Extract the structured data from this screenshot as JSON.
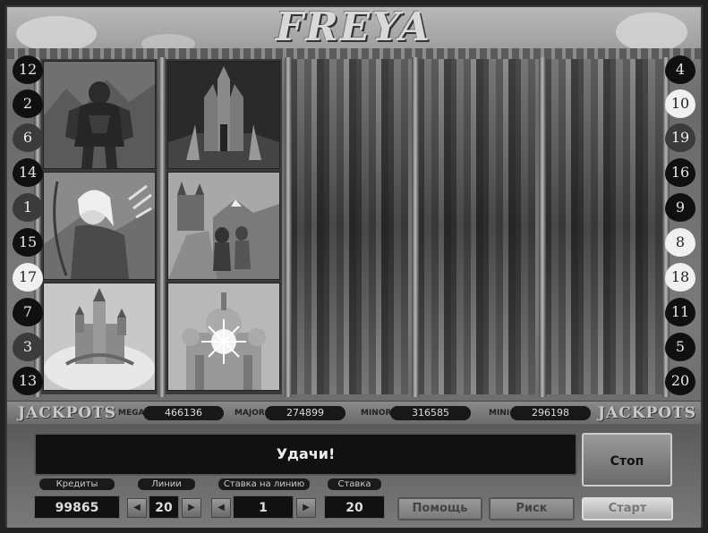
{
  "game": {
    "logo": "FREYA",
    "message": "Удачи!",
    "stop_label": "Стоп"
  },
  "lines_left": [
    "12",
    "2",
    "6",
    "14",
    "1",
    "15",
    "17",
    "7",
    "3",
    "13"
  ],
  "lines_right": [
    "4",
    "10",
    "19",
    "16",
    "9",
    "8",
    "18",
    "11",
    "5",
    "20"
  ],
  "reels": [
    {
      "symbols": [
        "warrior-troll",
        "elf-archer",
        "fairy-castle"
      ]
    },
    {
      "symbols": [
        "dark-cathedral",
        "mountain-travelers",
        "golden-temple"
      ]
    },
    {
      "symbols": [
        "spinning",
        "spinning",
        "spinning"
      ]
    },
    {
      "symbols": [
        "spinning",
        "spinning",
        "spinning"
      ]
    },
    {
      "symbols": [
        "spinning",
        "spinning",
        "spinning"
      ]
    }
  ],
  "jackpots": {
    "title_left": "JACKPOTS",
    "title_right": "JACKPOTS",
    "mega_label": "MEGA:",
    "mega_value": "466136",
    "major_label": "MAJOR:",
    "major_value": "274899",
    "minor_label": "MINOR:",
    "minor_value": "316585",
    "mini_label": "MINI:",
    "mini_value": "296198"
  },
  "controls": {
    "credits_label": "Кредиты",
    "credits_value": "99865",
    "lines_label": "Линии",
    "lines_value": "20",
    "bet_per_line_label": "Ставка на линию",
    "bet_per_line_value": "1",
    "bet_label": "Ставка",
    "bet_value": "20",
    "help_label": "Помощь",
    "risk_label": "Риск",
    "start_label": "Старт"
  }
}
